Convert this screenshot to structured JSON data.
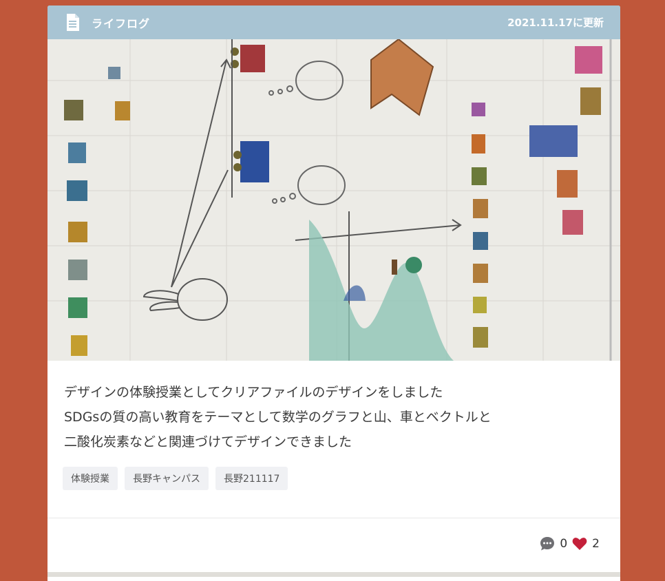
{
  "header": {
    "title": "ライフログ",
    "updated": "2021.11.17に更新",
    "icon": "document-icon"
  },
  "photo": {
    "icon": "drawing-photo"
  },
  "post": {
    "lines": [
      "デザインの体験授業としてクリアファイルのデザインをしました",
      "SDGsの質の高い教育をテーマとして数学のグラフと山、車とベクトルと",
      "二酸化炭素などと関連づけてデザインできました"
    ]
  },
  "tags": [
    "体験授業",
    "長野キャンパス",
    "長野211117"
  ],
  "reactions": {
    "comments": "0",
    "likes": "2",
    "comment_icon": "comment-icon",
    "like_icon": "heart-icon",
    "like_color": "#c4203a"
  },
  "colors": {
    "background": "#c0573a",
    "header": "#a8c4d3"
  }
}
